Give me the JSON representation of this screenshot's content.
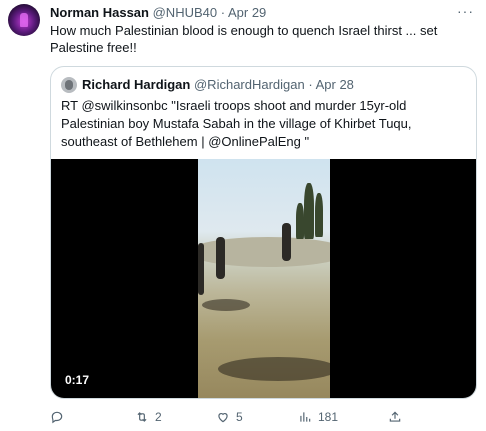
{
  "tweet": {
    "author_name": "Norman Hassan",
    "author_handle": "@NHUB40",
    "separator": "·",
    "date": "Apr 29",
    "more_icon": "more-icon",
    "text": "How much Palestinian blood is enough to  quench  Israel thirst ... set Palestine free!!"
  },
  "quote": {
    "author_name": "Richard Hardigan",
    "author_handle": "@RichardHardigan",
    "separator": "·",
    "date": "Apr 28",
    "text": "RT @swilkinsonbc \"Israeli troops shoot and murder 15yr-old Palestinian boy Mustafa Sabah in the village of Khirbet Tuqu, southeast of Bethlehem | @OnlinePalEng \"",
    "video_duration": "0:17"
  },
  "actions": {
    "reply_icon": "reply-icon",
    "reply_count": "",
    "retweet_icon": "retweet-icon",
    "retweet_count": "2",
    "like_icon": "heart-icon",
    "like_count": "5",
    "views_icon": "views-icon",
    "views_count": "181",
    "share_icon": "share-icon"
  },
  "colors": {
    "text": "#0f1419",
    "secondary": "#536471",
    "border": "#cfd9de"
  }
}
